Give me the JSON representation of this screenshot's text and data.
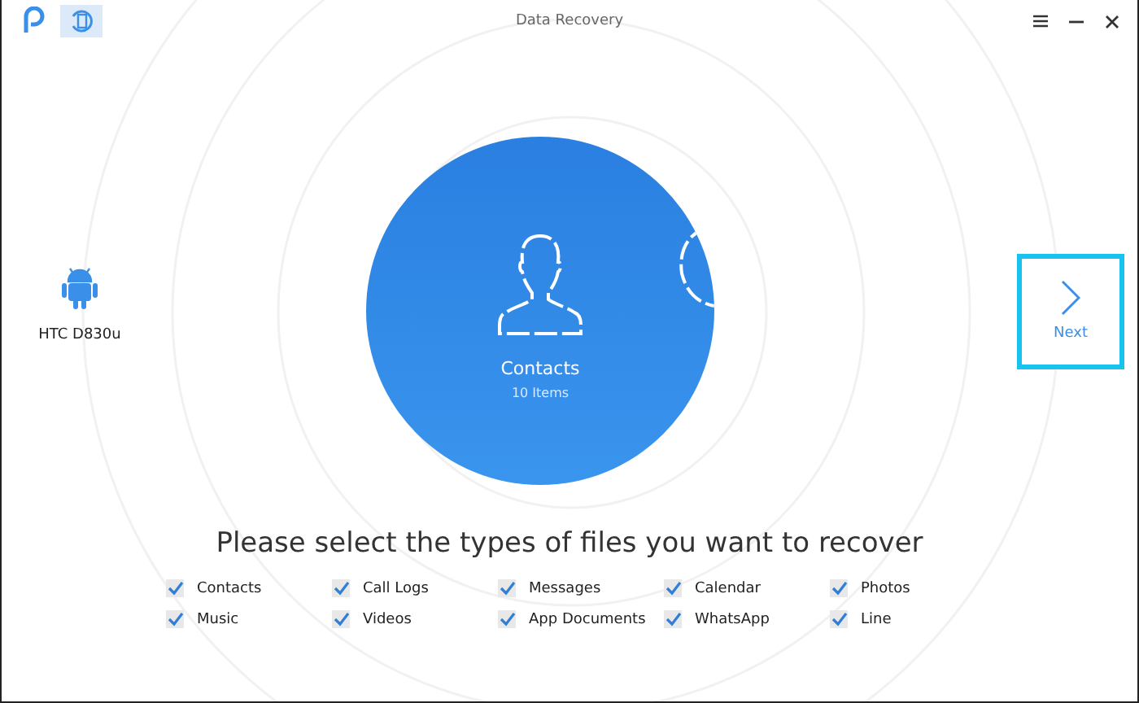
{
  "window": {
    "title": "Data Recovery"
  },
  "device": {
    "name": "HTC D830u"
  },
  "carousel": {
    "label": "Contacts",
    "count": "10 Items"
  },
  "next_button": {
    "label": "Next",
    "highlighted": true
  },
  "prompt": "Please select the types of files you want to recover",
  "file_types": [
    {
      "label": "Contacts",
      "checked": true
    },
    {
      "label": "Call Logs",
      "checked": true
    },
    {
      "label": "Messages",
      "checked": true
    },
    {
      "label": "Calendar",
      "checked": true
    },
    {
      "label": "Photos",
      "checked": true
    },
    {
      "label": "Music",
      "checked": true
    },
    {
      "label": "Videos",
      "checked": true
    },
    {
      "label": "App Documents",
      "checked": true
    },
    {
      "label": "WhatsApp",
      "checked": true
    },
    {
      "label": "Line",
      "checked": true
    }
  ]
}
